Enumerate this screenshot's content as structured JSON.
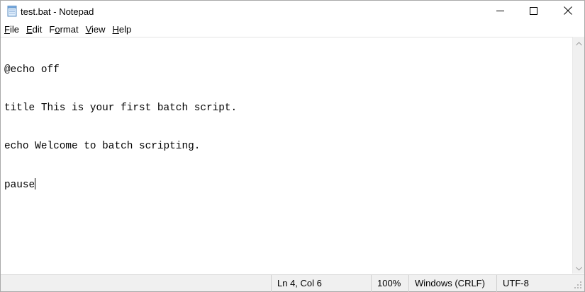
{
  "window": {
    "title": "test.bat - Notepad",
    "app_icon": "notepad-icon"
  },
  "title_controls": {
    "minimize_icon": "minimize-icon",
    "maximize_icon": "maximize-icon",
    "close_icon": "close-icon"
  },
  "menu": {
    "items": [
      {
        "accel": "F",
        "rest": "ile"
      },
      {
        "accel": "E",
        "rest": "dit"
      },
      {
        "pre": "F",
        "accel": "o",
        "rest": "rmat"
      },
      {
        "accel": "V",
        "rest": "iew"
      },
      {
        "accel": "H",
        "rest": "elp"
      }
    ]
  },
  "editor": {
    "lines": [
      "@echo off",
      "title This is your first batch script.",
      "echo Welcome to batch scripting.",
      "pause"
    ]
  },
  "status": {
    "position": "Ln 4, Col 6",
    "zoom": "100%",
    "line_endings": "Windows (CRLF)",
    "encoding": "UTF-8"
  }
}
